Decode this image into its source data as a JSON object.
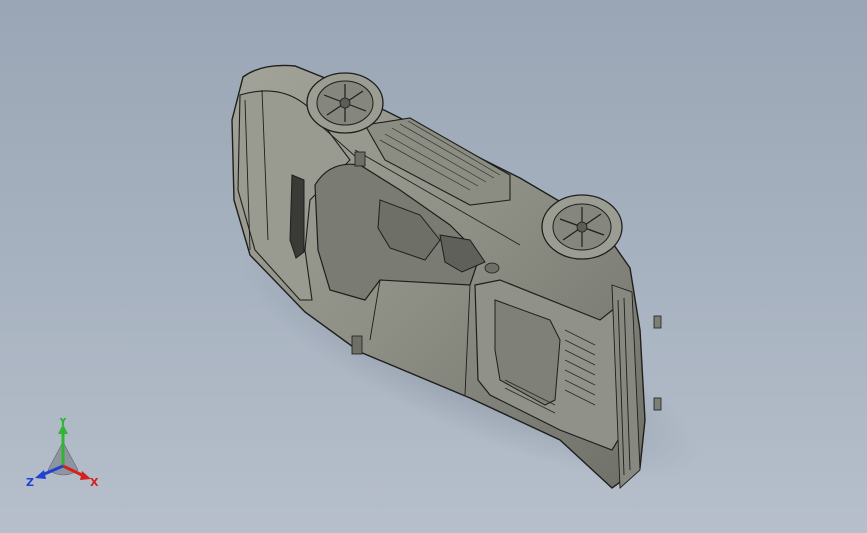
{
  "viewport": {
    "background_top": "#9aa6b5",
    "background_bottom": "#b6bfcb"
  },
  "model": {
    "body_color": "#8e8f85",
    "edge_color": "#1e1f1c"
  },
  "triad": {
    "x_label": "X",
    "y_label": "Y",
    "z_label": "Z",
    "x_color": "#d42020",
    "y_color": "#2fb52f",
    "z_color": "#2040d4"
  }
}
